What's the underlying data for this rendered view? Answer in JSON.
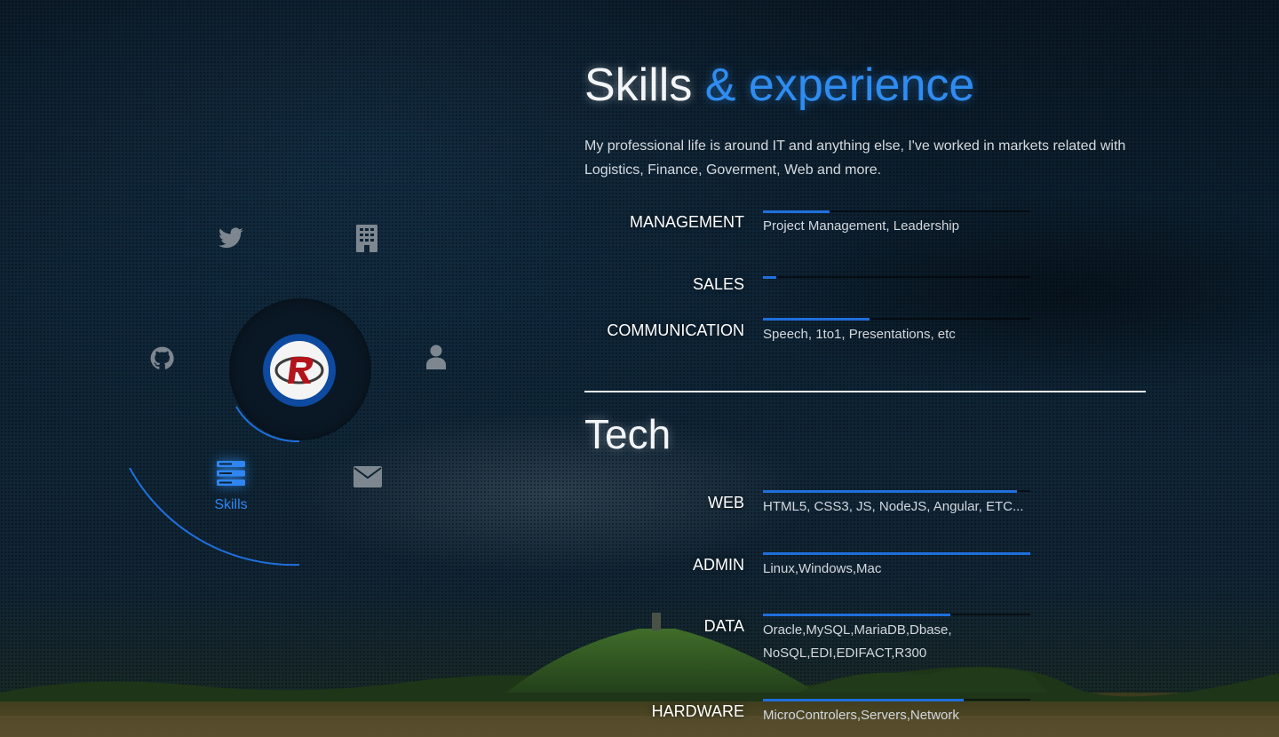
{
  "header": {
    "title_main": "Skills",
    "title_accent": "& experience",
    "intro": "My professional life is around IT and anything else, I've worked in markets related with Logistics, Finance, Goverment, Web and more."
  },
  "nav": {
    "items": [
      {
        "name": "twitter-icon"
      },
      {
        "name": "building-icon"
      },
      {
        "name": "github-icon"
      },
      {
        "name": "user-icon"
      },
      {
        "name": "skills-icon",
        "label": "Skills",
        "active": true
      },
      {
        "name": "envelope-icon"
      }
    ],
    "logo_letter": "R"
  },
  "skills": [
    {
      "name": "MANAGEMENT",
      "level": 0.25,
      "desc": "Project Management, Leadership"
    },
    {
      "name": "SALES",
      "level": 0.05,
      "desc": ""
    },
    {
      "name": "COMMUNICATION",
      "level": 0.4,
      "desc": "Speech, 1to1, Presentations, etc"
    }
  ],
  "tech_title": "Tech",
  "tech": [
    {
      "name": "WEB",
      "level": 0.95,
      "desc": "HTML5, CSS3, JS, NodeJS, Angular, ETC..."
    },
    {
      "name": "ADMIN",
      "level": 1.0,
      "desc": "Linux,Windows,Mac"
    },
    {
      "name": "DATA",
      "level": 0.7,
      "desc": "Oracle,MySQL,MariaDB,Dbase, NoSQL,EDI,EDIFACT,R300"
    },
    {
      "name": "HARDWARE",
      "level": 0.75,
      "desc": "MicroControlers,Servers,Network"
    }
  ],
  "colors": {
    "accent": "#2f8cf0",
    "bar": "#1f6fdc",
    "icon": "#7e8790"
  }
}
